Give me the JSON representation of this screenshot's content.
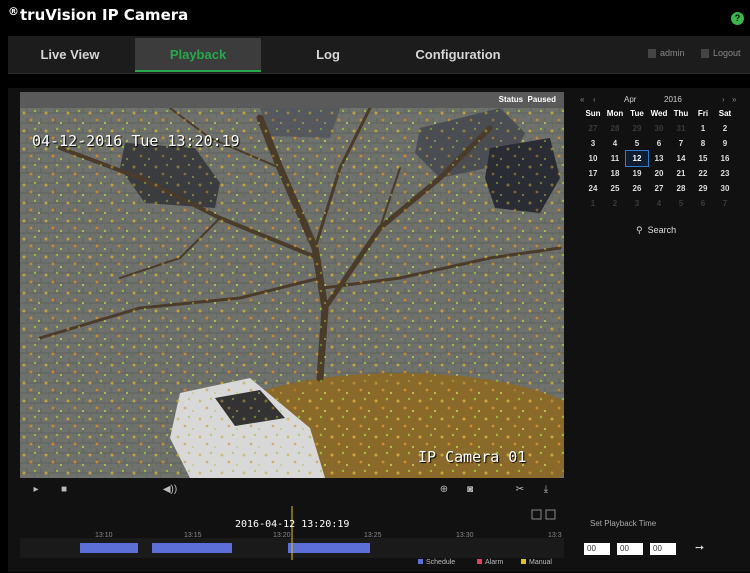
{
  "header": {
    "brand_icon": "trademark-icon",
    "brand": "truVision IP Camera",
    "help_icon": "?"
  },
  "nav": {
    "tabs": [
      {
        "label": "Live View",
        "active": false
      },
      {
        "label": "Playback",
        "active": true
      },
      {
        "label": "Log",
        "active": false
      },
      {
        "label": "Configuration",
        "active": false
      }
    ],
    "user": "admin",
    "logout": "Logout"
  },
  "status": {
    "label": "Status",
    "value": "Paused"
  },
  "video": {
    "timestamp": "04-12-2016 Tue 13:20:19",
    "camera_name": "IP Camera 01"
  },
  "calendar": {
    "month": "Apr",
    "year": "2016",
    "weekdays": [
      "Sun",
      "Mon",
      "Tue",
      "Wed",
      "Thu",
      "Fri",
      "Sat"
    ],
    "days": [
      [
        "27",
        "28",
        "29",
        "30",
        "31",
        "1",
        "2"
      ],
      [
        "3",
        "4",
        "5",
        "6",
        "7",
        "8",
        "9"
      ],
      [
        "10",
        "11",
        "12",
        "13",
        "14",
        "15",
        "16"
      ],
      [
        "17",
        "18",
        "19",
        "20",
        "21",
        "22",
        "23"
      ],
      [
        "24",
        "25",
        "26",
        "27",
        "28",
        "29",
        "30"
      ],
      [
        "1",
        "2",
        "3",
        "4",
        "5",
        "6",
        "7"
      ]
    ],
    "selected_day": "12",
    "search_label": "Search"
  },
  "timeline": {
    "current": "2016-04-12 13:20:19",
    "ticks": [
      "13:10",
      "13:15",
      "13:20",
      "13:25",
      "13:30",
      "13:3"
    ],
    "legend": [
      {
        "label": "Schedule",
        "color": "#5b6fd6"
      },
      {
        "label": "Alarm",
        "color": "#e04060"
      },
      {
        "label": "Manual",
        "color": "#e0c020"
      }
    ]
  },
  "playback_time": {
    "label": "Set Playback Time",
    "hour": "00",
    "minute": "00",
    "second": "00"
  },
  "colors": {
    "accent": "#27a84a",
    "selection": "#2b7bd6"
  }
}
